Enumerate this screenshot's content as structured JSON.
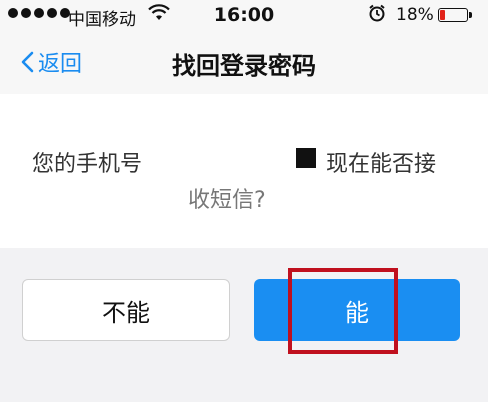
{
  "status": {
    "carrier": "中国移动",
    "time": "16:00",
    "battery_percent": "18%",
    "battery_level": 0.18
  },
  "nav": {
    "back_label": "返回",
    "title": "找回登录密码"
  },
  "message": {
    "left": "您的手机号",
    "right": "现在能否接",
    "bottom": "收短信?"
  },
  "buttons": {
    "no_label": "不能",
    "yes_label": "能"
  },
  "colors": {
    "accent": "#1a8ef2",
    "highlight": "#c0101e",
    "battery_low": "#e2231a"
  }
}
